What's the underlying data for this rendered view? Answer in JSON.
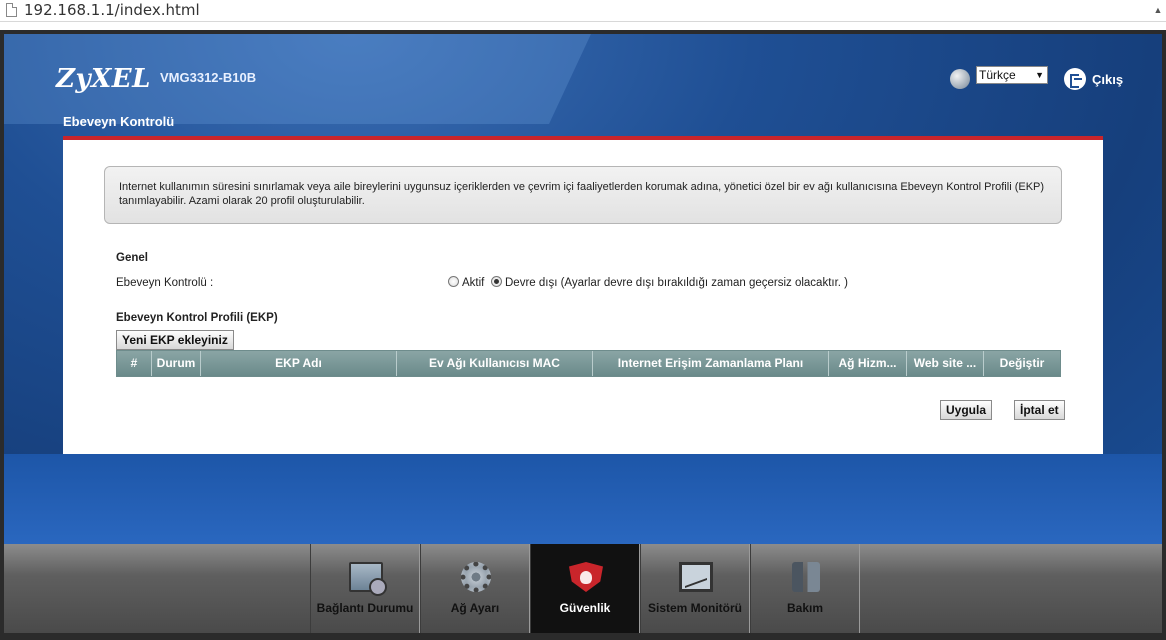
{
  "browser": {
    "url": "192.168.1.1/index.html"
  },
  "header": {
    "brand": "ZyXEL",
    "model": "VMG3312-B10B",
    "language": "Türkçe",
    "logout_label": "Çıkış"
  },
  "page": {
    "title": "Ebeveyn Kontrolü"
  },
  "info": {
    "text": "Internet kullanımın süresini sınırlamak veya aile bireylerini uygunsuz içeriklerden ve çevrim içi faaliyetlerden korumak adına, yönetici özel bir ev ağı kullanıcısına Ebeveyn Kontrol Profili (EKP) tanımlayabilir. Azami olarak 20 profil oluşturulabilir."
  },
  "general": {
    "section_title": "Genel",
    "field_label": "Ebeveyn Kontrolü :",
    "option_active": "Aktif",
    "option_disabled": "Devre dışı (Ayarlar devre dışı bırakıldığı zaman geçersiz olacaktır. )",
    "selected": "Devre dışı"
  },
  "profiles": {
    "section_title": "Ebeveyn Kontrol Profili (EKP)",
    "add_button": "Yeni EKP ekleyiniz",
    "columns": [
      "#",
      "Durum",
      "EKP Adı",
      "Ev Ağı Kullanıcısı MAC",
      "Internet Erişim Zamanlama Planı",
      "Ağ Hizm...",
      "Web site ...",
      "Değiştir"
    ]
  },
  "actions": {
    "apply": "Uygula",
    "cancel": "İptal et"
  },
  "nav": {
    "items": [
      {
        "label": "Bağlantı Durumu",
        "icon": "connection-status-icon"
      },
      {
        "label": "Ağ Ayarı",
        "icon": "gear-icon"
      },
      {
        "label": "Güvenlik",
        "icon": "shield-icon",
        "active": true
      },
      {
        "label": "Sistem Monitörü",
        "icon": "monitor-chart-icon"
      },
      {
        "label": "Bakım",
        "icon": "maintenance-tools-icon"
      }
    ]
  },
  "colors": {
    "accent_red": "#c9252b",
    "background_blue": "#1f4f94",
    "table_header": "#7a9898"
  }
}
